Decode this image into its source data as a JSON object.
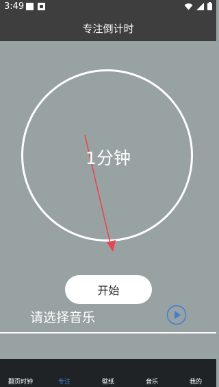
{
  "status_bar": {
    "time": "3:49"
  },
  "header": {
    "title": "专注倒计时"
  },
  "timer": {
    "display": "1分钟"
  },
  "controls": {
    "start_label": "开始",
    "music_label": "请选择音乐"
  },
  "nav": {
    "items": [
      {
        "label": "翻页时钟",
        "active": false
      },
      {
        "label": "专注",
        "active": true
      },
      {
        "label": "壁纸",
        "active": false
      },
      {
        "label": "音乐",
        "active": false
      },
      {
        "label": "我的",
        "active": false
      }
    ]
  },
  "colors": {
    "bar": "#3e3e3e",
    "background": "#99a2a2",
    "accent": "#3d7fd4",
    "hand": "#e8454d",
    "nav": "#1f2326"
  }
}
